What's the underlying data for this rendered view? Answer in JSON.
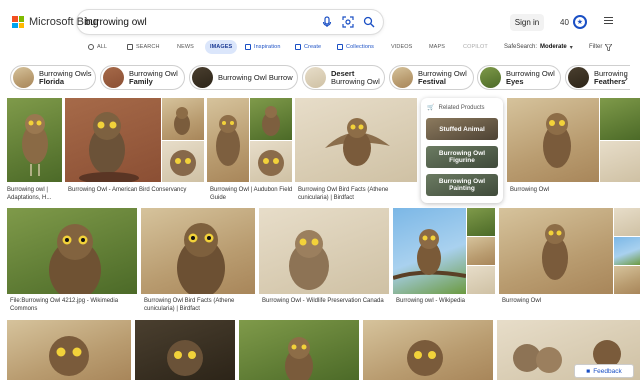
{
  "header": {
    "logo_text": "Microsoft Bing",
    "search_value": "burrowing owl",
    "sign_in": "Sign in",
    "reward_points": "40"
  },
  "nav": {
    "tabs": [
      {
        "label": "ALL"
      },
      {
        "label": "SEARCH"
      },
      {
        "label": "NEWS"
      },
      {
        "label": "IMAGES"
      },
      {
        "label": "Inspiration"
      },
      {
        "label": "Create"
      },
      {
        "label": "Collections"
      },
      {
        "label": "VIDEOS"
      },
      {
        "label": "MAPS"
      },
      {
        "label": "COPILOT"
      }
    ],
    "safesearch_label": "SafeSearch:",
    "safesearch_value": "Moderate",
    "filter_label": "Filter"
  },
  "related": [
    {
      "line1": "Burrowing Owls",
      "line2": "Florida"
    },
    {
      "line1": "Burrowing Owl",
      "line2": "Family"
    },
    {
      "line1": "Burrowing Owl Burrow",
      "line2": ""
    },
    {
      "line1": "Desert",
      "line2": "Burrowing Owl"
    },
    {
      "line1": "Burrowing Owl",
      "line2": "Festival"
    },
    {
      "line1": "Burrowing Owl",
      "line2": "Eyes"
    },
    {
      "line1": "Burrowing",
      "line2": "Feathers"
    }
  ],
  "captions": {
    "c1": "Burrowing owl | Adaptations, H...",
    "c2": "Burrowing Owl - American Bird Conservancy",
    "c3": "Burrowing Owl | Audubon Field Guide",
    "c4": "Burrowing Owl Bird Facts (Athene cunicularia) | Birdfact",
    "c5": "Burrowing Owl",
    "c6": "File:Burrowing Owl 4212.jpg - Wikimedia Commons",
    "c7": "Burrowing Owl Bird Facts (Athene cunicularia) | Birdfact",
    "c8": "Burrowing Owl - Wildlife Preservation Canada",
    "c9": "Burrowing owl - Wikipedia",
    "c10": "Burrowing Owl"
  },
  "related_products": {
    "title": "Related Products",
    "items": [
      "Stuffed Animal",
      "Burrowing Owl Figurine",
      "Burrowing Owl Painting"
    ]
  },
  "feedback": "Feedback"
}
